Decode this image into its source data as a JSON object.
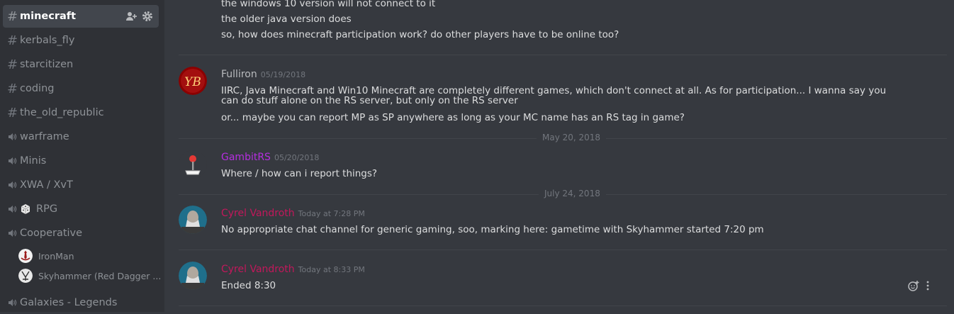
{
  "sidebar": {
    "channels": [
      {
        "label": "minecraft",
        "type": "text",
        "active": true
      },
      {
        "label": "kerbals_fly",
        "type": "text"
      },
      {
        "label": "starcitizen",
        "type": "text"
      },
      {
        "label": "coding",
        "type": "text"
      },
      {
        "label": "the_old_republic",
        "type": "text"
      },
      {
        "label": "warframe",
        "type": "voice"
      },
      {
        "label": "Minis",
        "type": "voice"
      },
      {
        "label": "XWA / XvT",
        "type": "voice"
      },
      {
        "label": "RPG",
        "type": "voice",
        "emoji": "dice"
      },
      {
        "label": "Cooperative",
        "type": "voice"
      },
      {
        "label": "Galaxies - Legends",
        "type": "voice"
      }
    ],
    "voice_users": [
      {
        "name": "IronMan"
      },
      {
        "name": "Skyhammer (Red Dagger ..."
      }
    ]
  },
  "messages": {
    "cont_lines": [
      "the windows 10 version will not connect to it",
      "the older java version does",
      "so, how does minecraft participation work? do other players have to be online too?"
    ],
    "m1": {
      "author": "Fulliron",
      "timestamp": "05/19/2018",
      "color": "#b9bbbe",
      "avatar_text": "YB",
      "lines": [
        "IIRC, Java Minecraft and Win10 Minecraft are completely different games, which don't connect at all. As for participation... I wanna say you can do stuff alone on the RS server, but only on the RS server",
        "or... maybe you can report MP as SP anywhere as long as your MC name has an RS tag in game?"
      ]
    },
    "divider1": "May 20, 2018",
    "m2": {
      "author": "GambitRS",
      "timestamp": "05/20/2018",
      "color": "#b52ee0",
      "lines": [
        "Where / how can i report things?"
      ]
    },
    "divider2": "July 24, 2018",
    "m3": {
      "author": "Cyrel Vandroth",
      "timestamp": "Today at 7:28 PM",
      "color": "#c2185b",
      "lines": [
        "No appropriate chat channel for generic gaming, soo, marking here: gametime with Skyhammer started 7:20 pm"
      ]
    },
    "m4": {
      "author": "Cyrel Vandroth",
      "timestamp": "Today at 8:33 PM",
      "color": "#c2185b",
      "lines": [
        "Ended 8:30"
      ]
    }
  },
  "colors": {
    "bg": "#36393f",
    "sidebar": "#2f3136",
    "text": "#dcddde",
    "muted": "#72767d"
  }
}
